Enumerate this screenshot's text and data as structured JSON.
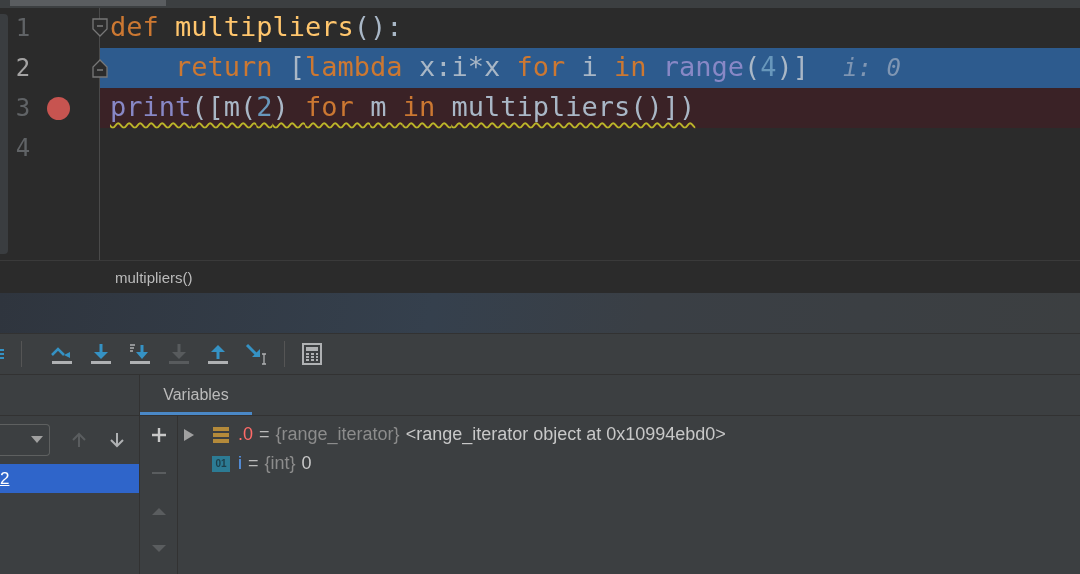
{
  "editor": {
    "lines": [
      {
        "number": "1",
        "kind": "fold-start",
        "breakpoint": false,
        "current": false,
        "warning": false,
        "tokens": [
          {
            "kind": "keyword",
            "text": "def "
          },
          {
            "kind": "function",
            "text": "multipliers"
          },
          {
            "kind": "plain",
            "text": "():"
          }
        ]
      },
      {
        "number": "2",
        "kind": "fold-end",
        "breakpoint": false,
        "current": true,
        "warning": false,
        "tokens": [
          {
            "kind": "keyword",
            "text": "    return "
          },
          {
            "kind": "plain",
            "text": "["
          },
          {
            "kind": "keyword",
            "text": "lambda "
          },
          {
            "kind": "plain",
            "text": "x:i*x "
          },
          {
            "kind": "keyword",
            "text": "for "
          },
          {
            "kind": "plain",
            "text": "i "
          },
          {
            "kind": "keyword",
            "text": "in "
          },
          {
            "kind": "builtin",
            "text": "range"
          },
          {
            "kind": "plain",
            "text": "("
          },
          {
            "kind": "number",
            "text": "4"
          },
          {
            "kind": "plain",
            "text": ")]"
          }
        ],
        "inline_value": "i: 0"
      },
      {
        "number": "3",
        "kind": "plain",
        "breakpoint": true,
        "current": false,
        "warning": true,
        "tokens": [
          {
            "kind": "builtin",
            "text": "print"
          },
          {
            "kind": "plain",
            "text": "([m("
          },
          {
            "kind": "number",
            "text": "2"
          },
          {
            "kind": "plain",
            "text": ") "
          },
          {
            "kind": "keyword",
            "text": "for "
          },
          {
            "kind": "plain",
            "text": "m "
          },
          {
            "kind": "keyword",
            "text": "in "
          },
          {
            "kind": "plain",
            "text": "multipliers()])"
          }
        ]
      },
      {
        "number": "4",
        "kind": "plain",
        "breakpoint": false,
        "current": false
      }
    ],
    "breadcrumb": "multipliers()"
  },
  "toolbar": [
    {
      "kind": "step-over",
      "disabled": false
    },
    {
      "kind": "step-into",
      "disabled": false
    },
    {
      "kind": "step-into-my-code",
      "disabled": false
    },
    {
      "kind": "force-step-into",
      "disabled": true
    },
    {
      "kind": "step-out",
      "disabled": false
    },
    {
      "kind": "run-to-cursor",
      "disabled": false
    },
    {
      "kind": "separator"
    },
    {
      "kind": "evaluate",
      "disabled": false
    }
  ],
  "frames": {
    "nav": [
      {
        "kind": "up",
        "disabled": true
      },
      {
        "kind": "down",
        "disabled": false
      }
    ],
    "items": [
      {
        "label": "2",
        "selected": true
      }
    ]
  },
  "variables": {
    "tab": {
      "label": "Variables",
      "selected": true
    },
    "side_buttons": [
      {
        "kind": "add",
        "disabled": false
      },
      {
        "kind": "remove",
        "disabled": true
      },
      {
        "kind": "up",
        "disabled": true
      },
      {
        "kind": "down",
        "disabled": true
      }
    ],
    "rows": [
      {
        "kind": "object",
        "expandable": true,
        "name": ".0",
        "sep": "=",
        "type": "{range_iterator}",
        "value": "<range_iterator object at 0x10994ebd0>"
      },
      {
        "kind": "int",
        "expandable": false,
        "badge": "01",
        "name": "i",
        "sep": "=",
        "type": "{int}",
        "value": "0"
      }
    ]
  }
}
